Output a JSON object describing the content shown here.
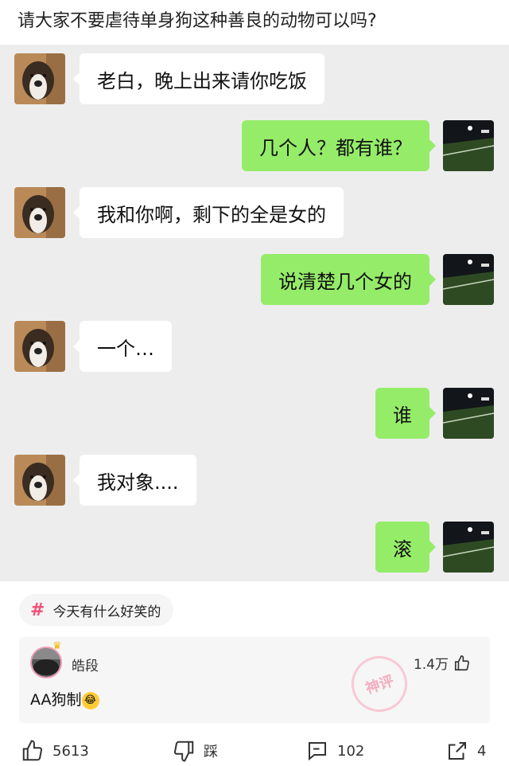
{
  "post": {
    "title": "请大家不要虐待单身狗这种善良的动物可以吗?"
  },
  "chat": [
    {
      "side": "left",
      "text": "老白，晚上出来请你吃饭"
    },
    {
      "side": "right",
      "text": "几个人？都有谁？"
    },
    {
      "side": "left",
      "text": "我和你啊，剩下的全是女的"
    },
    {
      "side": "right",
      "text": "说清楚几个女的"
    },
    {
      "side": "left",
      "text": "一个…"
    },
    {
      "side": "right",
      "text": "谁"
    },
    {
      "side": "left",
      "text": "我对象...."
    },
    {
      "side": "right",
      "text": "滚"
    }
  ],
  "topic": {
    "label": "今天有什么好笑的",
    "icon": "hashtag-icon"
  },
  "comment": {
    "username": "皓段",
    "likes": "1.4万",
    "text": "AA狗制",
    "emoji": "laughing-crying-emoji",
    "stamp_text": "神评"
  },
  "actions": {
    "like_count": "5613",
    "dislike_label": "踩",
    "comment_count": "102",
    "share_count": "4"
  },
  "colors": {
    "bubble_right": "#95ec69",
    "chat_bg": "#ededed",
    "hash": "#f0507a"
  }
}
